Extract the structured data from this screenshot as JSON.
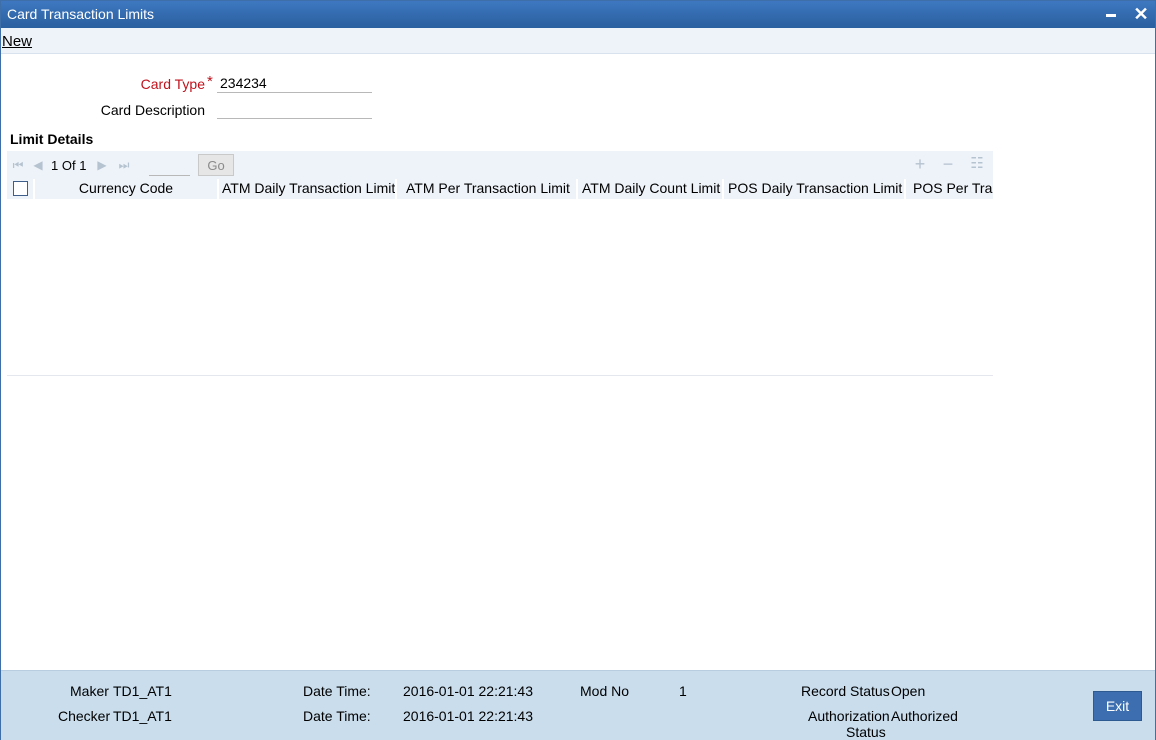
{
  "window": {
    "title": "Card Transaction Limits"
  },
  "menu": {
    "new_label": "New"
  },
  "form": {
    "card_type_label": "Card Type",
    "required_mark": "*",
    "card_type_value": "234234",
    "card_description_label": "Card Description",
    "card_description_value": ""
  },
  "limit_details": {
    "title": "Limit Details",
    "pagination": {
      "current": "1",
      "of_label": "Of",
      "total": "1",
      "go_label": "Go"
    },
    "columns": [
      "Currency Code",
      "ATM Daily Transaction Limit",
      "ATM Per Transaction Limit",
      "ATM Daily Count Limit",
      "POS Daily Transaction Limit",
      "POS Per Tran"
    ]
  },
  "footer": {
    "maker_label": "Maker",
    "maker_value": "TD1_AT1",
    "checker_label": "Checker",
    "checker_value": "TD1_AT1",
    "maker_datetime_label": "Date Time:",
    "maker_datetime_value": "2016-01-01 22:21:43",
    "checker_datetime_label": "Date Time:",
    "checker_datetime_value": "2016-01-01 22:21:43",
    "mod_no_label": "Mod No",
    "mod_no_value": "1",
    "record_status_label": "Record Status",
    "record_status_value": "Open",
    "auth_status_label_line1": "Authorization",
    "auth_status_label_line2": "Status",
    "auth_status_value": "Authorized",
    "exit_label": "Exit"
  },
  "colors": {
    "titlebar": "#2f66ad",
    "required": "#c0121c",
    "footer_bg": "#c9dded",
    "exit_button": "#3d6fb0"
  }
}
